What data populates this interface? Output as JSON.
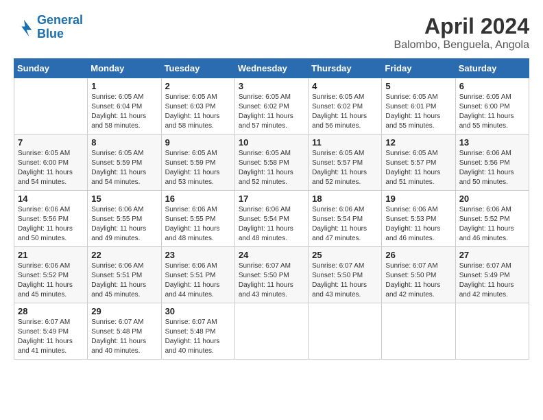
{
  "logo": {
    "line1": "General",
    "line2": "Blue"
  },
  "title": "April 2024",
  "subtitle": "Balombo, Benguela, Angola",
  "headers": [
    "Sunday",
    "Monday",
    "Tuesday",
    "Wednesday",
    "Thursday",
    "Friday",
    "Saturday"
  ],
  "weeks": [
    [
      {
        "day": "",
        "info": ""
      },
      {
        "day": "1",
        "info": "Sunrise: 6:05 AM\nSunset: 6:04 PM\nDaylight: 11 hours\nand 58 minutes."
      },
      {
        "day": "2",
        "info": "Sunrise: 6:05 AM\nSunset: 6:03 PM\nDaylight: 11 hours\nand 58 minutes."
      },
      {
        "day": "3",
        "info": "Sunrise: 6:05 AM\nSunset: 6:02 PM\nDaylight: 11 hours\nand 57 minutes."
      },
      {
        "day": "4",
        "info": "Sunrise: 6:05 AM\nSunset: 6:02 PM\nDaylight: 11 hours\nand 56 minutes."
      },
      {
        "day": "5",
        "info": "Sunrise: 6:05 AM\nSunset: 6:01 PM\nDaylight: 11 hours\nand 55 minutes."
      },
      {
        "day": "6",
        "info": "Sunrise: 6:05 AM\nSunset: 6:00 PM\nDaylight: 11 hours\nand 55 minutes."
      }
    ],
    [
      {
        "day": "7",
        "info": "Sunrise: 6:05 AM\nSunset: 6:00 PM\nDaylight: 11 hours\nand 54 minutes."
      },
      {
        "day": "8",
        "info": "Sunrise: 6:05 AM\nSunset: 5:59 PM\nDaylight: 11 hours\nand 54 minutes."
      },
      {
        "day": "9",
        "info": "Sunrise: 6:05 AM\nSunset: 5:59 PM\nDaylight: 11 hours\nand 53 minutes."
      },
      {
        "day": "10",
        "info": "Sunrise: 6:05 AM\nSunset: 5:58 PM\nDaylight: 11 hours\nand 52 minutes."
      },
      {
        "day": "11",
        "info": "Sunrise: 6:05 AM\nSunset: 5:57 PM\nDaylight: 11 hours\nand 52 minutes."
      },
      {
        "day": "12",
        "info": "Sunrise: 6:05 AM\nSunset: 5:57 PM\nDaylight: 11 hours\nand 51 minutes."
      },
      {
        "day": "13",
        "info": "Sunrise: 6:06 AM\nSunset: 5:56 PM\nDaylight: 11 hours\nand 50 minutes."
      }
    ],
    [
      {
        "day": "14",
        "info": "Sunrise: 6:06 AM\nSunset: 5:56 PM\nDaylight: 11 hours\nand 50 minutes."
      },
      {
        "day": "15",
        "info": "Sunrise: 6:06 AM\nSunset: 5:55 PM\nDaylight: 11 hours\nand 49 minutes."
      },
      {
        "day": "16",
        "info": "Sunrise: 6:06 AM\nSunset: 5:55 PM\nDaylight: 11 hours\nand 48 minutes."
      },
      {
        "day": "17",
        "info": "Sunrise: 6:06 AM\nSunset: 5:54 PM\nDaylight: 11 hours\nand 48 minutes."
      },
      {
        "day": "18",
        "info": "Sunrise: 6:06 AM\nSunset: 5:54 PM\nDaylight: 11 hours\nand 47 minutes."
      },
      {
        "day": "19",
        "info": "Sunrise: 6:06 AM\nSunset: 5:53 PM\nDaylight: 11 hours\nand 46 minutes."
      },
      {
        "day": "20",
        "info": "Sunrise: 6:06 AM\nSunset: 5:52 PM\nDaylight: 11 hours\nand 46 minutes."
      }
    ],
    [
      {
        "day": "21",
        "info": "Sunrise: 6:06 AM\nSunset: 5:52 PM\nDaylight: 11 hours\nand 45 minutes."
      },
      {
        "day": "22",
        "info": "Sunrise: 6:06 AM\nSunset: 5:51 PM\nDaylight: 11 hours\nand 45 minutes."
      },
      {
        "day": "23",
        "info": "Sunrise: 6:06 AM\nSunset: 5:51 PM\nDaylight: 11 hours\nand 44 minutes."
      },
      {
        "day": "24",
        "info": "Sunrise: 6:07 AM\nSunset: 5:50 PM\nDaylight: 11 hours\nand 43 minutes."
      },
      {
        "day": "25",
        "info": "Sunrise: 6:07 AM\nSunset: 5:50 PM\nDaylight: 11 hours\nand 43 minutes."
      },
      {
        "day": "26",
        "info": "Sunrise: 6:07 AM\nSunset: 5:50 PM\nDaylight: 11 hours\nand 42 minutes."
      },
      {
        "day": "27",
        "info": "Sunrise: 6:07 AM\nSunset: 5:49 PM\nDaylight: 11 hours\nand 42 minutes."
      }
    ],
    [
      {
        "day": "28",
        "info": "Sunrise: 6:07 AM\nSunset: 5:49 PM\nDaylight: 11 hours\nand 41 minutes."
      },
      {
        "day": "29",
        "info": "Sunrise: 6:07 AM\nSunset: 5:48 PM\nDaylight: 11 hours\nand 40 minutes."
      },
      {
        "day": "30",
        "info": "Sunrise: 6:07 AM\nSunset: 5:48 PM\nDaylight: 11 hours\nand 40 minutes."
      },
      {
        "day": "",
        "info": ""
      },
      {
        "day": "",
        "info": ""
      },
      {
        "day": "",
        "info": ""
      },
      {
        "day": "",
        "info": ""
      }
    ]
  ]
}
